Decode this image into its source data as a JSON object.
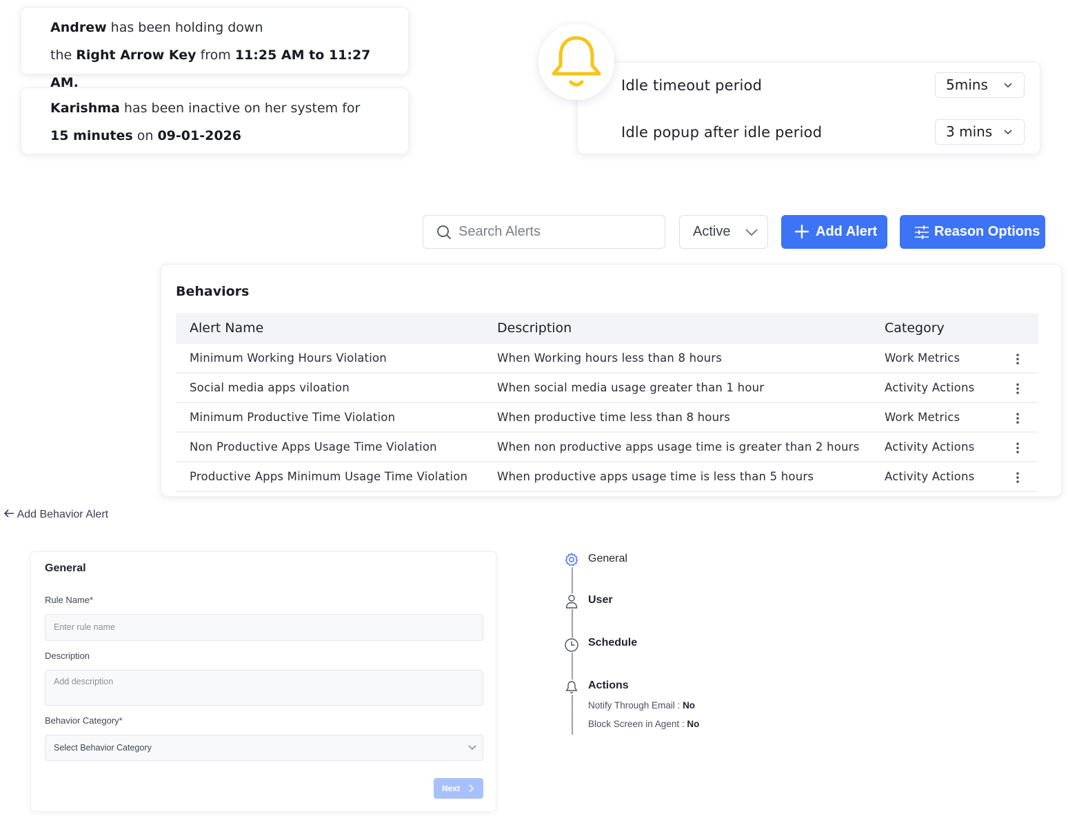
{
  "notifications": [
    {
      "line1": {
        "name": "Andrew",
        "text": " has been holding down"
      },
      "line2": {
        "prefix": "the ",
        "key": "Right Arrow Key",
        "mid": " from ",
        "time": "11:25 AM to 11:27 AM."
      }
    },
    {
      "line1": {
        "name": "Karishma",
        "text": " has been inactive on her system for"
      },
      "line2": {
        "duration": "15 minutes",
        "mid": " on ",
        "date": "09-01-2026"
      }
    }
  ],
  "idle_settings": {
    "timeout_label": "Idle timeout period",
    "timeout_value": "5mins",
    "popup_label": "Idle popup after idle period",
    "popup_value": "3 mins",
    "bell_color": "#f5c518"
  },
  "toolbar": {
    "search_placeholder": "Search Alerts",
    "status_value": "Active",
    "add_alert_label": "Add Alert",
    "reason_options_label": "Reason Options",
    "accent_color": "#3d74f5"
  },
  "behaviors": {
    "title": "Behaviors",
    "columns": [
      "Alert Name",
      "Description",
      "Category"
    ],
    "rows": [
      {
        "name": "Minimum Working Hours Violation",
        "description": "When Working hours less than 8 hours",
        "category": "Work Metrics"
      },
      {
        "name": "Social media apps viloation",
        "description": "When social media usage greater than 1 hour",
        "category": "Activity Actions"
      },
      {
        "name": "Minimum Productive Time Violation",
        "description": "When productive time less than 8 hours",
        "category": "Work Metrics"
      },
      {
        "name": "Non Productive Apps Usage Time Violation",
        "description": "When non productive apps usage time is greater than 2 hours",
        "category": "Activity Actions"
      },
      {
        "name": "Productive Apps Minimum Usage Time Violation",
        "description": "When productive apps usage time is less than 5 hours",
        "category": "Activity Actions"
      }
    ]
  },
  "add_behavior": {
    "back_label": "Add Behavior Alert",
    "section_title": "General",
    "rule_name_label": "Rule Name*",
    "rule_name_placeholder": "Enter rule name",
    "description_label": "Description",
    "description_placeholder": "Add description",
    "category_label": "Behavior Category*",
    "category_placeholder": "Select Behavior Category",
    "next_label": "Next"
  },
  "stepper": {
    "steps": [
      "General",
      "User",
      "Schedule",
      "Actions"
    ],
    "notify_label": "Notify Through Email : ",
    "notify_value": "No",
    "block_label": "Block Screen in Agent : ",
    "block_value": "No"
  }
}
